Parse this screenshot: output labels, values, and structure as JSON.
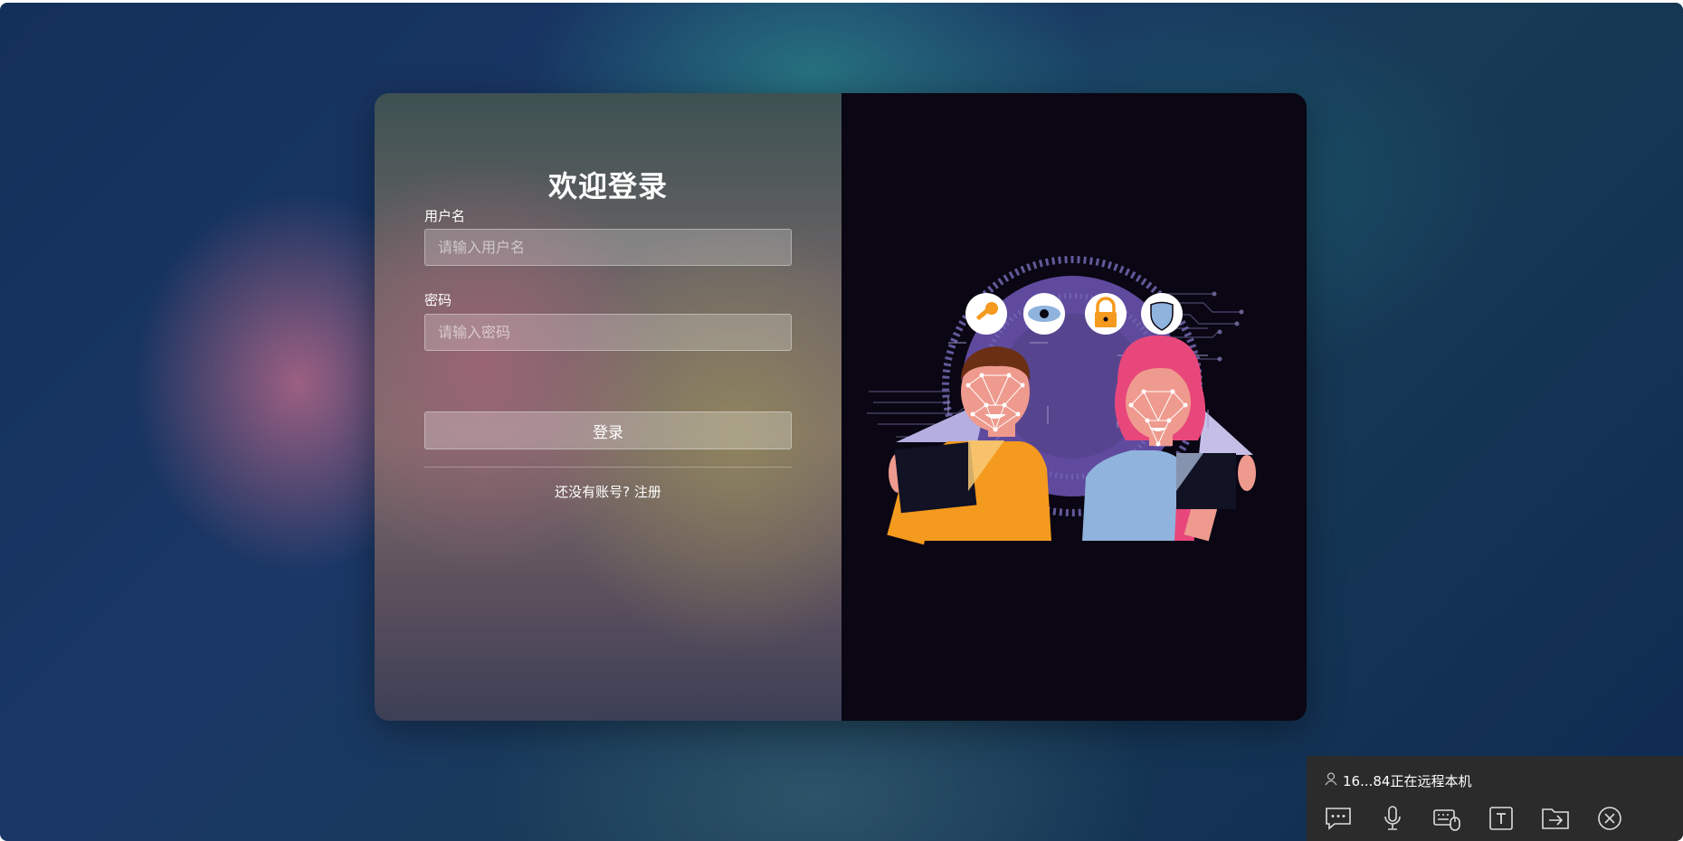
{
  "login": {
    "title": "欢迎登录",
    "username_label": "用户名",
    "username_placeholder": "请输入用户名",
    "password_label": "密码",
    "password_placeholder": "请输入密码",
    "login_button": "登录",
    "register_link": "还没有账号? 注册"
  },
  "illustration": {
    "icons": [
      "key-icon",
      "eye-icon",
      "lock-icon",
      "shield-icon"
    ]
  },
  "remote_toolbar": {
    "status_text": "16...84正在远程本机",
    "buttons": [
      "chat-icon",
      "microphone-icon",
      "keyboard-mouse-icon",
      "text-icon",
      "file-transfer-icon",
      "close-icon"
    ]
  },
  "colors": {
    "card_right_bg": "#0a0613",
    "toolbar_bg": "#2b2b2b",
    "accent_orange": "#f49a1e",
    "accent_purple": "#5f4a9e",
    "accent_pink": "#e8477b",
    "accent_blue": "#8fb3dd"
  }
}
